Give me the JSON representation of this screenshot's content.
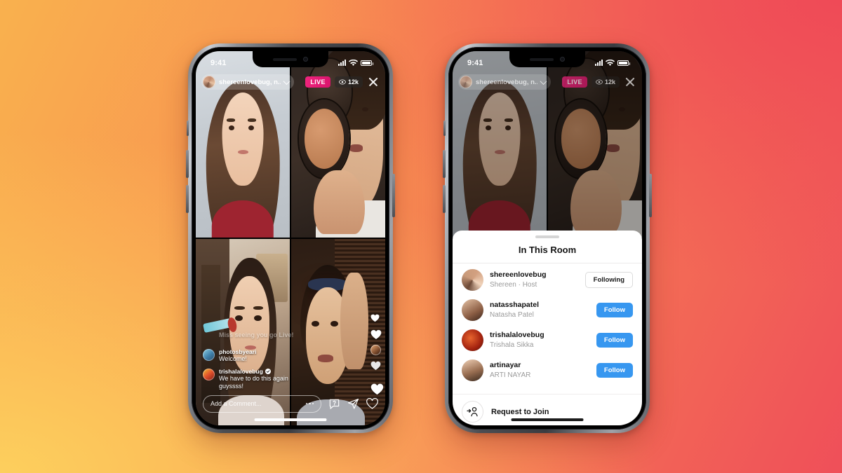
{
  "background": {
    "gradient_from": "#f9b14e",
    "gradient_mid": "#f88a52",
    "gradient_to": "#ef4f59"
  },
  "status_bar": {
    "time": "9:41",
    "signal": "cellular-bars",
    "wifi": "wifi-icon",
    "battery": "battery-full-icon"
  },
  "live_header": {
    "host_handle": "shereenlovebug, n...",
    "chevron": "chevron-down-icon",
    "live_label": "LIVE",
    "viewer_count": "12k",
    "viewer_icon": "eye-icon",
    "close": "close-icon"
  },
  "video_grid": {
    "tiles": [
      {
        "id": "tile-host",
        "alt": "woman smiling in light room"
      },
      {
        "id": "tile-guest-1",
        "alt": "woman holding makeup compact"
      },
      {
        "id": "tile-guest-2",
        "alt": "woman applying eyeshadow"
      },
      {
        "id": "tile-guest-3",
        "alt": "woman in front of wooden shutters"
      }
    ]
  },
  "comments": [
    {
      "user": "",
      "text": "Miss seeing you go Live!",
      "verified": false,
      "faded": true
    },
    {
      "user": "photosbyeari",
      "text": "Welcome!",
      "verified": false,
      "faded": false
    },
    {
      "user": "trishalalovebug",
      "text": "We have to do this again guyssss!",
      "verified": true,
      "faded": false
    }
  ],
  "reactions": {
    "heart_icon": "heart-icon",
    "count_visible": 4
  },
  "comment_bar": {
    "placeholder": "Add a Comment...",
    "more_icon": "ellipsis-icon",
    "question_icon": "question-sticker-icon",
    "send_icon": "send-icon",
    "like_icon": "heart-icon"
  },
  "room_sheet": {
    "title": "In This Room",
    "grabber": "drag-handle",
    "people": [
      {
        "handle": "shereenlovebug",
        "name": "Shereen · Host",
        "action": "Following",
        "action_style": "outline"
      },
      {
        "handle": "natasshapatel",
        "name": "Natasha Patel",
        "action": "Follow",
        "action_style": "primary"
      },
      {
        "handle": "trishalalovebug",
        "name": "Trishala Sikka",
        "action": "Follow",
        "action_style": "primary"
      },
      {
        "handle": "artinayar",
        "name": "ARTI NAYAR",
        "action": "Follow",
        "action_style": "primary"
      }
    ],
    "footer": {
      "label": "Request to Join",
      "icon": "add-person-icon"
    }
  },
  "colors": {
    "live_badge": "#ed1f79",
    "follow_button": "#3797f0",
    "verified_badge": "#ffffff"
  }
}
